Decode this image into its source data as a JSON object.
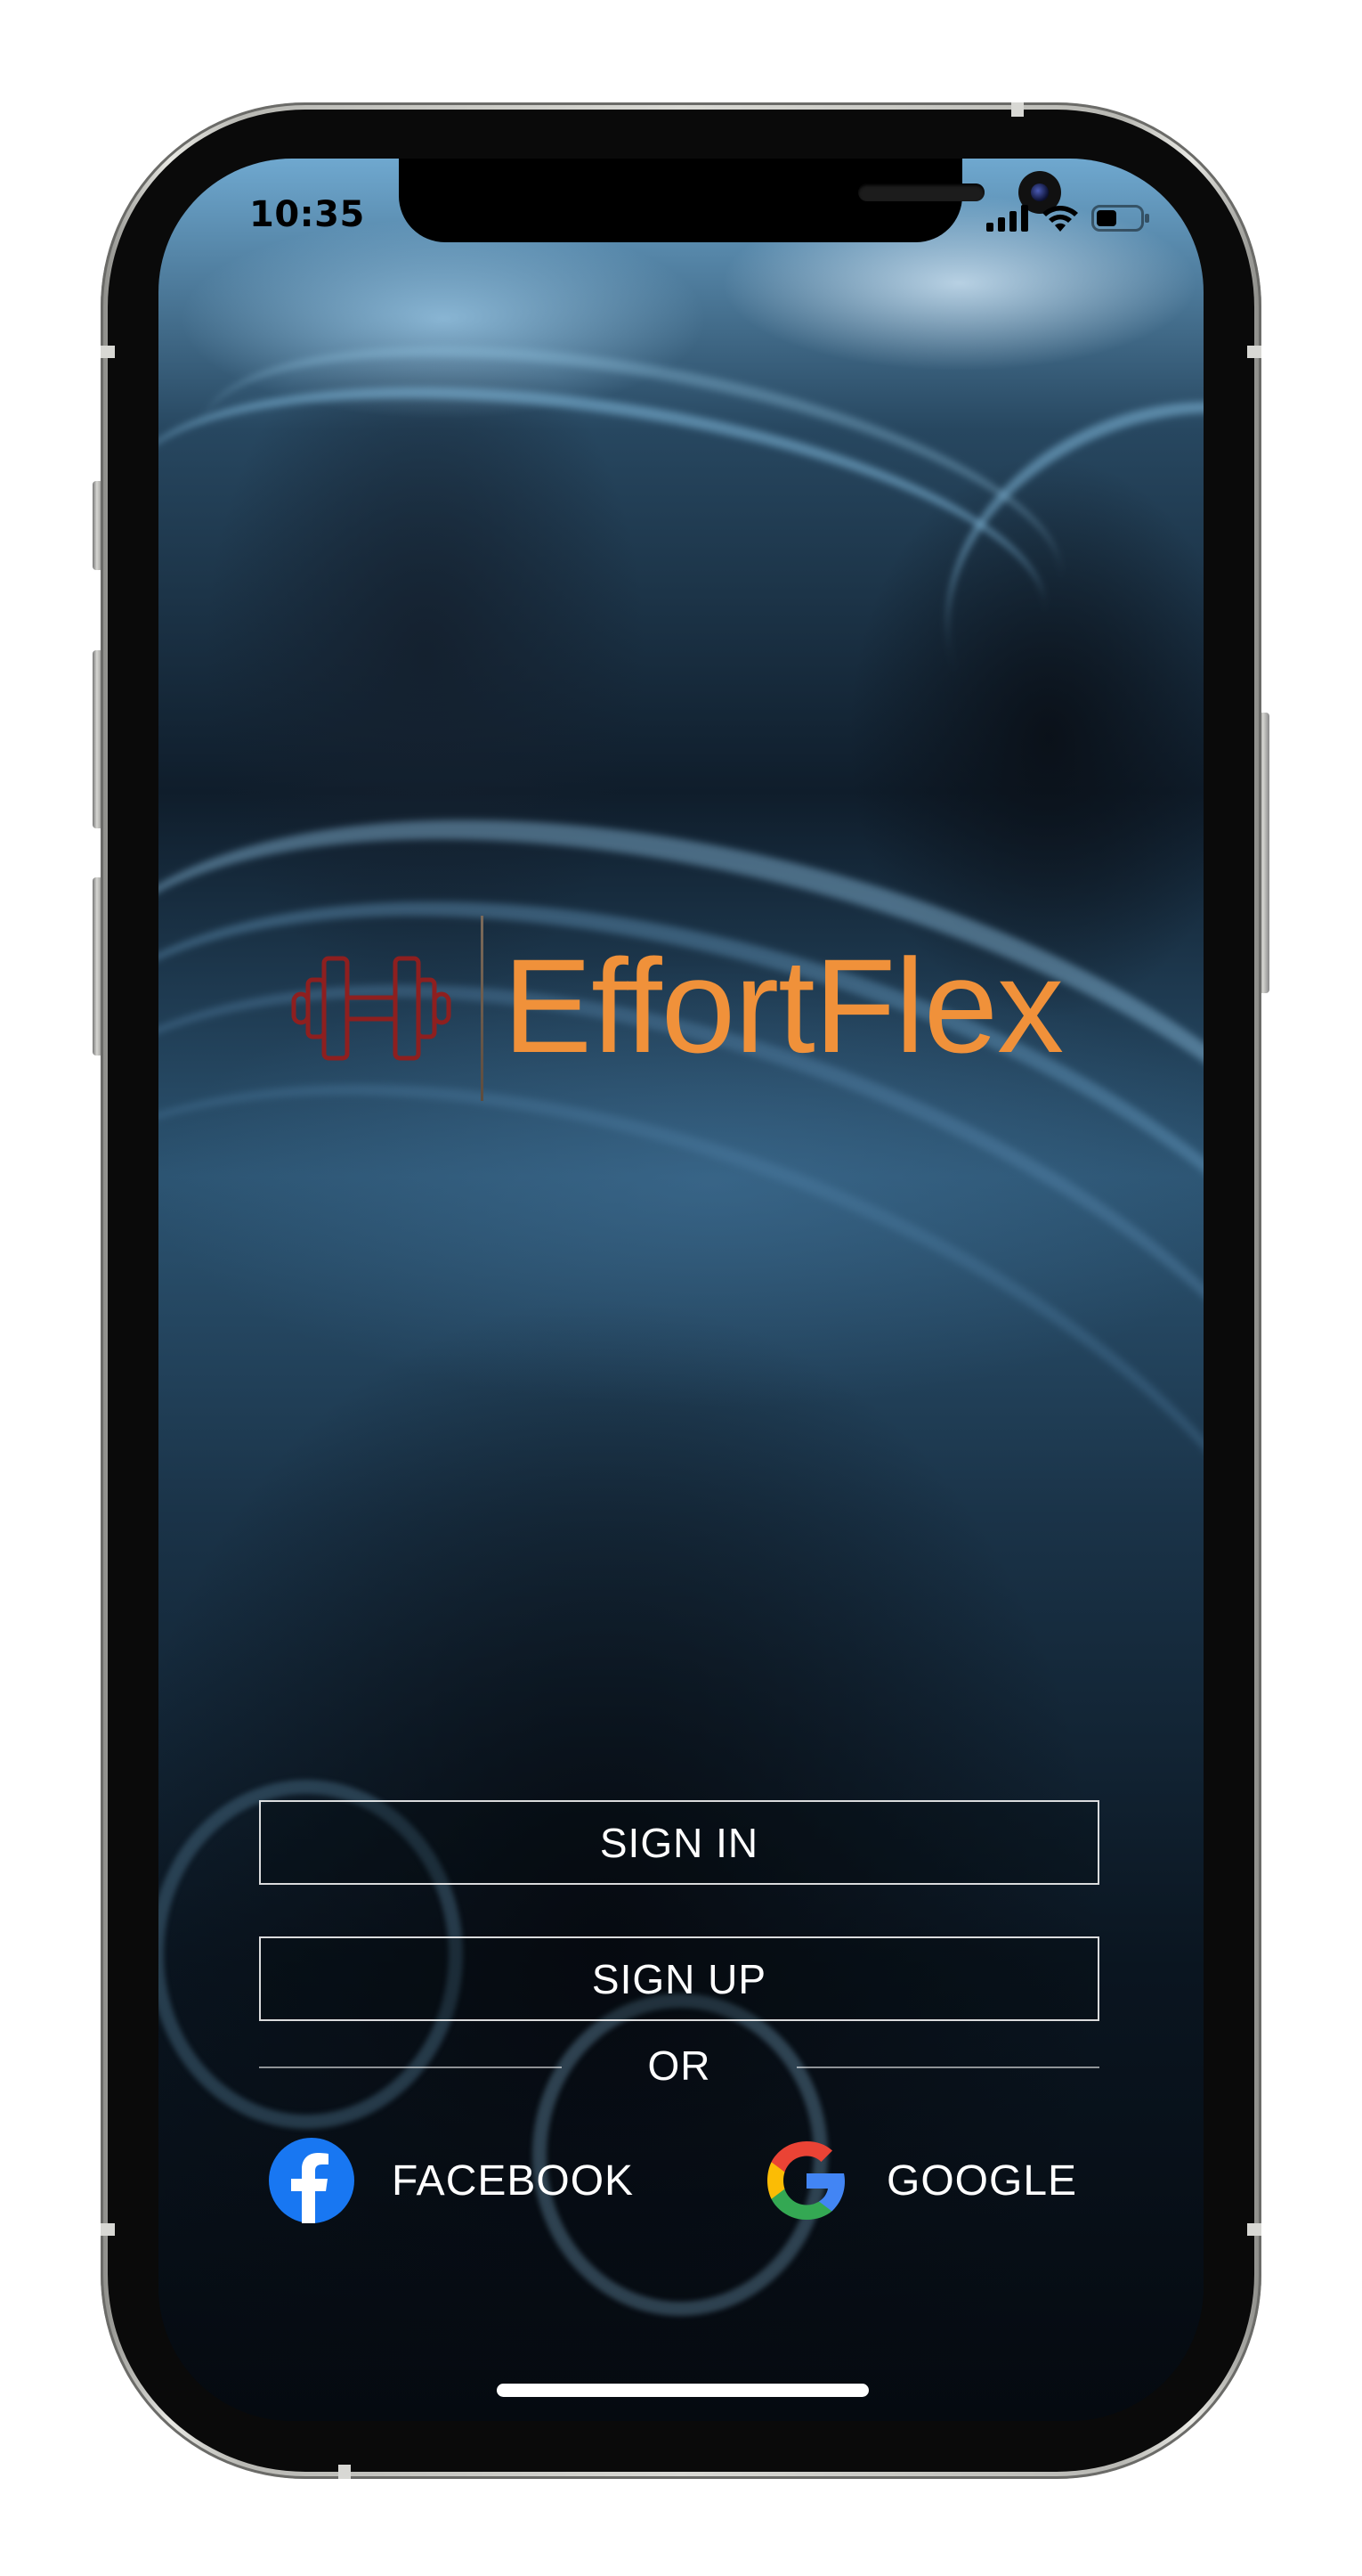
{
  "status_bar": {
    "time": "10:35",
    "icons": [
      "cellular-signal-icon",
      "wifi-icon",
      "battery-icon"
    ]
  },
  "brand": {
    "name": "EffortFlex",
    "logo_icon": "dumbbell-icon",
    "logo_text_color": "#F0913A",
    "logo_icon_color": "#8E1F1F"
  },
  "auth": {
    "sign_in_label": "SIGN IN",
    "sign_up_label": "SIGN UP",
    "divider_text": "OR",
    "social": [
      {
        "provider_icon": "facebook-icon",
        "label": "FACEBOOK"
      },
      {
        "provider_icon": "google-icon",
        "label": "GOOGLE"
      }
    ]
  },
  "colors": {
    "facebook_blue": "#1877F2",
    "google_blue": "#4285F4",
    "google_red": "#EA4335",
    "google_yellow": "#FBBC05",
    "google_green": "#34A853"
  }
}
